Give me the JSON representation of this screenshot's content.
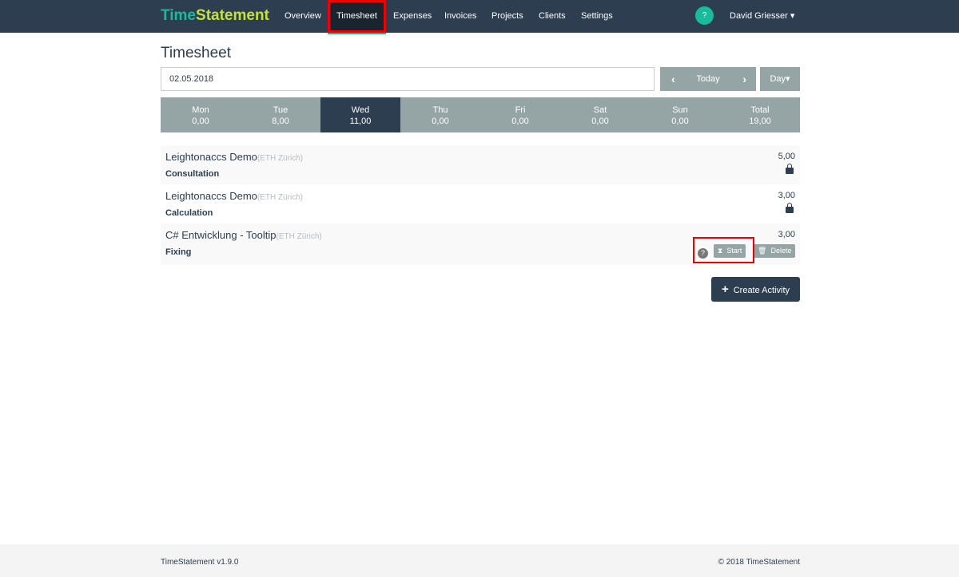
{
  "brand": {
    "part1": "Time",
    "part2": "Statement"
  },
  "nav": [
    "Overview",
    "Timesheet",
    "Expenses",
    "Invoices",
    "Projects",
    "Clients",
    "Settings"
  ],
  "help_label": "?",
  "user": "David Griesser",
  "title": "Timesheet",
  "date": "02.05.2018",
  "today_label": "Today",
  "view_label": "Day",
  "week": [
    {
      "day": "Mon",
      "hours": "0,00"
    },
    {
      "day": "Tue",
      "hours": "8,00"
    },
    {
      "day": "Wed",
      "hours": "11,00"
    },
    {
      "day": "Thu",
      "hours": "0,00"
    },
    {
      "day": "Fri",
      "hours": "0,00"
    },
    {
      "day": "Sat",
      "hours": "0,00"
    },
    {
      "day": "Sun",
      "hours": "0,00"
    },
    {
      "day": "Total",
      "hours": "19,00"
    }
  ],
  "entries": [
    {
      "project": "Leightonaccs Demo",
      "client": "(ETH Zürich)",
      "activity": "Consultation",
      "hours": "5,00"
    },
    {
      "project": "Leightonaccs Demo",
      "client": "(ETH Zürich)",
      "activity": "Calculation",
      "hours": "3,00"
    },
    {
      "project": "C# Entwicklung - Tooltip",
      "client": "(ETH Zürich)",
      "activity": "Fixing",
      "hours": "3,00"
    }
  ],
  "start_label": "Start",
  "delete_label": "Delete",
  "create_label": "Create Activity",
  "footer": {
    "version": "TimeStatement v1.9.0",
    "copyright": "© 2018 TimeStatement"
  }
}
